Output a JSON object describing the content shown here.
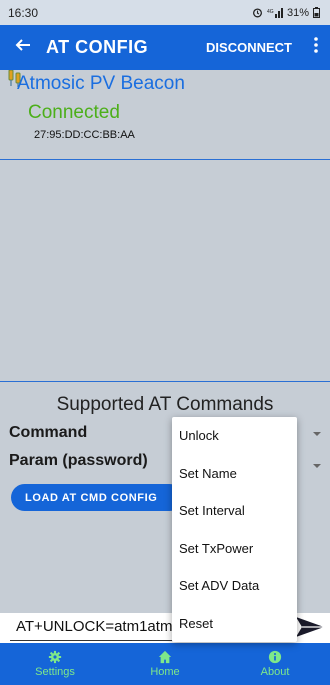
{
  "status": {
    "time": "16:30",
    "indicators": "31%"
  },
  "appbar": {
    "title": "AT CONFIG",
    "disconnect_label": "DISCONNECT"
  },
  "device": {
    "name": "Atmosic PV Beacon",
    "state": "Connected",
    "mac": "27:95:DD:CC:BB:AA"
  },
  "commands": {
    "section_title": "Supported AT Commands",
    "command_label": "Command",
    "param_label": "Param (password)",
    "load_button": "LOAD AT CMD CONFIG"
  },
  "input": {
    "value": "AT+UNLOCK=atm1atm"
  },
  "menu": {
    "items": [
      "Unlock",
      "Set Name",
      "Set Interval",
      "Set TxPower",
      "Set ADV Data",
      "Reset"
    ]
  },
  "nav": {
    "items": [
      {
        "label": "Settings",
        "icon": "gear-icon"
      },
      {
        "label": "Home",
        "icon": "home-icon"
      },
      {
        "label": "About",
        "icon": "info-icon"
      }
    ]
  },
  "colors": {
    "primary": "#1565d8",
    "nav_text": "#7ee88a",
    "connected": "#4caf1a",
    "device_name": "#1a6ee0"
  }
}
